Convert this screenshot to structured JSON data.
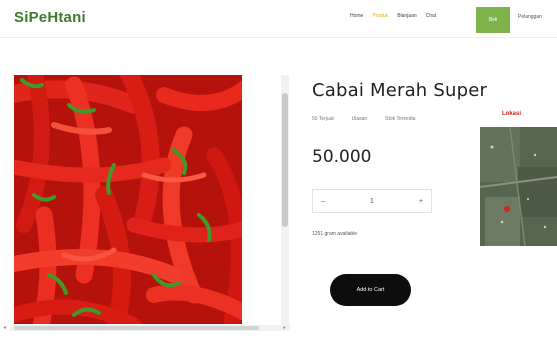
{
  "brand": {
    "name": "SiPeHtani"
  },
  "nav": {
    "links": [
      "Home",
      "Produk",
      "Blanjaan",
      "Chat"
    ],
    "active_index": 1,
    "button_label": "Beli",
    "user_label": "Pelanggan"
  },
  "product": {
    "title": "Cabai Merah Super",
    "meta_sold": "50 Terjual",
    "meta_rating": "Ulasan",
    "meta_stock": "Stok Tersedia",
    "price": "50.000",
    "quantity": "1",
    "qty_minus": "–",
    "qty_plus": "+",
    "available": "1251 gram available",
    "add_to_cart_label": "Add to Cart"
  },
  "location": {
    "label": "Lokasi"
  },
  "icons": {
    "scroll_left": "◂",
    "scroll_right": "▸"
  },
  "colors": {
    "brand": "#3f7a2e",
    "accent_green": "#7fb34c",
    "active_nav": "#e2b21a",
    "location_label": "#d2231c",
    "cart_button": "#0d0d0d"
  }
}
